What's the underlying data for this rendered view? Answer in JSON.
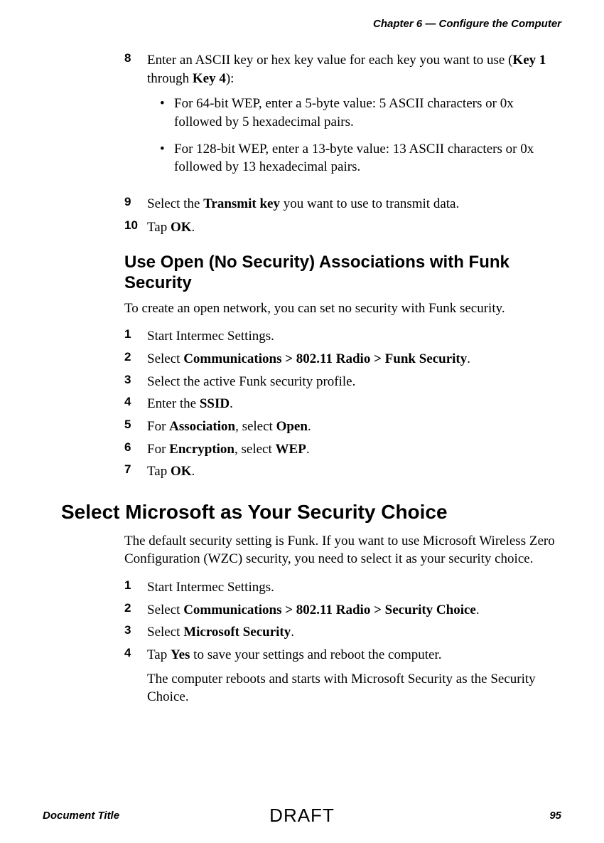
{
  "chapter_header": "Chapter 6 — Configure the Computer",
  "section1": {
    "step8": {
      "num": "8",
      "text_pre": "Enter an ASCII key or hex key value for each key you want to use (",
      "bold1": "Key 1",
      "mid": " through ",
      "bold2": "Key 4",
      "text_post": "):",
      "bullets": [
        "For 64-bit WEP, enter a 5-byte value: 5 ASCII characters or 0x followed by 5 hexadecimal pairs.",
        "For 128-bit WEP, enter a 13-byte value: 13 ASCII characters or 0x followed by 13 hexadecimal pairs."
      ]
    },
    "step9": {
      "num": "9",
      "text_pre": "Select the ",
      "bold": "Transmit key",
      "text_post": " you want to use to transmit data."
    },
    "step10": {
      "num": "10",
      "text_pre": "Tap ",
      "bold": "OK",
      "text_post": "."
    }
  },
  "section2": {
    "heading": "Use Open (No Security) Associations with Funk Security",
    "intro": "To create an open network, you can set no security with Funk security.",
    "steps": {
      "s1": {
        "num": "1",
        "text": "Start Intermec Settings."
      },
      "s2": {
        "num": "2",
        "pre": "Select ",
        "bold": "Communications > 802.11 Radio > Funk Security",
        "post": "."
      },
      "s3": {
        "num": "3",
        "text": "Select the active Funk security profile."
      },
      "s4": {
        "num": "4",
        "pre": "Enter the ",
        "bold": "SSID",
        "post": "."
      },
      "s5": {
        "num": "5",
        "pre": "For ",
        "bold1": "Association",
        "mid": ", select ",
        "bold2": "Open",
        "post": "."
      },
      "s6": {
        "num": "6",
        "pre": "For ",
        "bold1": "Encryption",
        "mid": ", select ",
        "bold2": "WEP",
        "post": "."
      },
      "s7": {
        "num": "7",
        "pre": "Tap ",
        "bold": "OK",
        "post": "."
      }
    }
  },
  "section3": {
    "heading": "Select Microsoft as Your Security Choice",
    "intro": "The default security setting is Funk. If you want to use Microsoft Wireless Zero Configuration (WZC) security, you need to select it as your security choice.",
    "steps": {
      "s1": {
        "num": "1",
        "text": "Start Intermec Settings."
      },
      "s2": {
        "num": "2",
        "pre": "Select ",
        "bold": "Communications > 802.11 Radio > Security Choice",
        "post": "."
      },
      "s3": {
        "num": "3",
        "pre": "Select ",
        "bold": "Microsoft Security",
        "post": "."
      },
      "s4": {
        "num": "4",
        "pre": "Tap ",
        "bold": "Yes",
        "post": " to save your settings and reboot the computer."
      }
    },
    "followup": "The computer reboots and starts with Microsoft Security as the Security Choice."
  },
  "footer": {
    "left": "Document Title",
    "center": "DRAFT",
    "right": "95"
  }
}
